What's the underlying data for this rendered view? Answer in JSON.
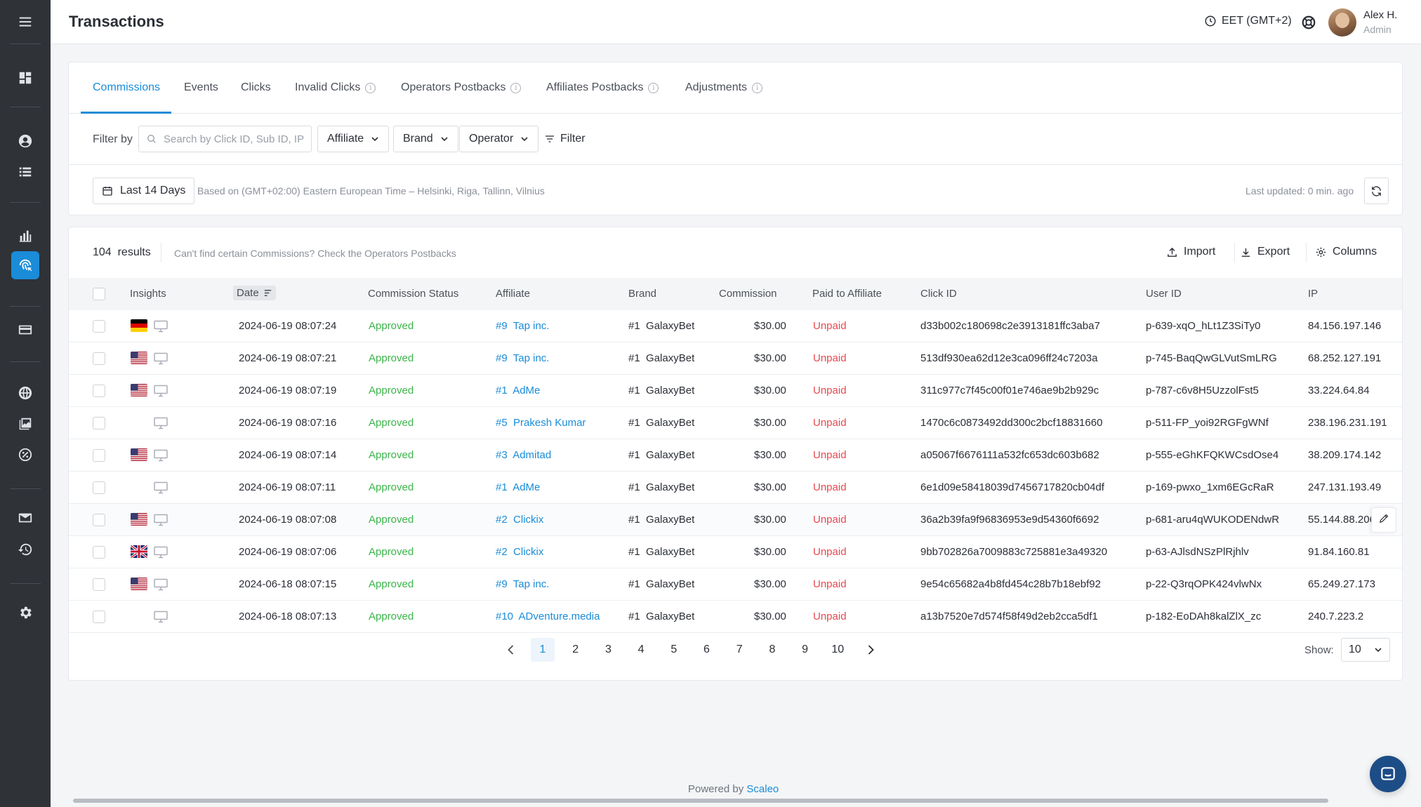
{
  "header": {
    "title": "Transactions",
    "timezone": "EET (GMT+2)",
    "user_name": "Alex H.",
    "user_role": "Admin"
  },
  "sidebar": {
    "icons": [
      "menu-icon",
      "dashboard-icon",
      "user-icon",
      "list-icon",
      "bar-chart-icon",
      "fingerprint-icon",
      "card-icon",
      "globe-icon",
      "image-icon",
      "percent-icon",
      "mail-icon",
      "history-icon",
      "gear-icon"
    ],
    "active": "fingerprint-icon"
  },
  "tabs": [
    {
      "label": "Commissions",
      "active": true,
      "info": false
    },
    {
      "label": "Events",
      "active": false,
      "info": false
    },
    {
      "label": "Clicks",
      "active": false,
      "info": false
    },
    {
      "label": "Invalid Clicks",
      "active": false,
      "info": true
    },
    {
      "label": "Operators Postbacks",
      "active": false,
      "info": true
    },
    {
      "label": "Affiliates Postbacks",
      "active": false,
      "info": true
    },
    {
      "label": "Adjustments",
      "active": false,
      "info": true
    }
  ],
  "filters": {
    "label": "Filter by",
    "search_placeholder": "Search by Click ID, Sub ID, IP",
    "search_value": "",
    "affiliate": "Affiliate",
    "brand": "Brand",
    "operator": "Operator",
    "filter_button": "Filter"
  },
  "date_range": {
    "label": "Last 14 Days",
    "note": "Based on (GMT+02:00) Eastern European Time – Helsinki, Riga, Tallinn, Vilnius",
    "last_updated": "Last updated: 0 min. ago"
  },
  "results": {
    "count": "104",
    "count_label": "results",
    "hint": "Can't find certain Commissions? Check the Operators Postbacks",
    "import": "Import",
    "export": "Export",
    "columns": "Columns"
  },
  "table": {
    "headers": [
      "Insights",
      "Date",
      "Commission Status",
      "Affiliate",
      "Brand",
      "Commission",
      "Paid to Affiliate",
      "Click ID",
      "User ID",
      "IP"
    ],
    "rows": [
      {
        "flag": "de",
        "date": "2024-06-19 08:07:24",
        "status": "Approved",
        "aff_id": "#9",
        "aff_name": "Tap inc.",
        "brand_id": "#1",
        "brand_name": "GalaxyBet",
        "commission": "$30.00",
        "paid": "Unpaid",
        "click_id": "d33b002c180698c2e3913181ffc3aba7",
        "user_id": "p-639-xqO_hLt1Z3SiTy0",
        "ip": "84.156.197.146"
      },
      {
        "flag": "us",
        "date": "2024-06-19 08:07:21",
        "status": "Approved",
        "aff_id": "#9",
        "aff_name": "Tap inc.",
        "brand_id": "#1",
        "brand_name": "GalaxyBet",
        "commission": "$30.00",
        "paid": "Unpaid",
        "click_id": "513df930ea62d12e3ca096ff24c7203a",
        "user_id": "p-745-BaqQwGLVutSmLRG",
        "ip": "68.252.127.191"
      },
      {
        "flag": "us",
        "date": "2024-06-19 08:07:19",
        "status": "Approved",
        "aff_id": "#1",
        "aff_name": "AdMe",
        "brand_id": "#1",
        "brand_name": "GalaxyBet",
        "commission": "$30.00",
        "paid": "Unpaid",
        "click_id": "311c977c7f45c00f01e746ae9b2b929c",
        "user_id": "p-787-c6v8H5UzzolFst5",
        "ip": "33.224.64.84"
      },
      {
        "flag": "",
        "date": "2024-06-19 08:07:16",
        "status": "Approved",
        "aff_id": "#5",
        "aff_name": "Prakesh Kumar",
        "brand_id": "#1",
        "brand_name": "GalaxyBet",
        "commission": "$30.00",
        "paid": "Unpaid",
        "click_id": "1470c6c0873492dd300c2bcf18831660",
        "user_id": "p-511-FP_yoi92RGFgWNf",
        "ip": "238.196.231.191"
      },
      {
        "flag": "us",
        "date": "2024-06-19 08:07:14",
        "status": "Approved",
        "aff_id": "#3",
        "aff_name": "Admitad",
        "brand_id": "#1",
        "brand_name": "GalaxyBet",
        "commission": "$30.00",
        "paid": "Unpaid",
        "click_id": "a05067f6676111a532fc653dc603b682",
        "user_id": "p-555-eGhKFQKWCsdOse4",
        "ip": "38.209.174.142"
      },
      {
        "flag": "",
        "date": "2024-06-19 08:07:11",
        "status": "Approved",
        "aff_id": "#1",
        "aff_name": "AdMe",
        "brand_id": "#1",
        "brand_name": "GalaxyBet",
        "commission": "$30.00",
        "paid": "Unpaid",
        "click_id": "6e1d09e58418039d7456717820cb04df",
        "user_id": "p-169-pwxo_1xm6EGcRaR",
        "ip": "247.131.193.49"
      },
      {
        "flag": "us",
        "date": "2024-06-19 08:07:08",
        "status": "Approved",
        "aff_id": "#2",
        "aff_name": "Clickix",
        "brand_id": "#1",
        "brand_name": "GalaxyBet",
        "commission": "$30.00",
        "paid": "Unpaid",
        "click_id": "36a2b39fa9f96836953e9d54360f6692",
        "user_id": "p-681-aru4qWUKODENdwR",
        "ip": "55.144.88.206"
      },
      {
        "flag": "gb",
        "date": "2024-06-19 08:07:06",
        "status": "Approved",
        "aff_id": "#2",
        "aff_name": "Clickix",
        "brand_id": "#1",
        "brand_name": "GalaxyBet",
        "commission": "$30.00",
        "paid": "Unpaid",
        "click_id": "9bb702826a7009883c725881e3a49320",
        "user_id": "p-63-AJlsdNSzPlRjhlv",
        "ip": "91.84.160.81"
      },
      {
        "flag": "us",
        "date": "2024-06-18 08:07:15",
        "status": "Approved",
        "aff_id": "#9",
        "aff_name": "Tap inc.",
        "brand_id": "#1",
        "brand_name": "GalaxyBet",
        "commission": "$30.00",
        "paid": "Unpaid",
        "click_id": "9e54c65682a4b8fd454c28b7b18ebf92",
        "user_id": "p-22-Q3rqOPK424vlwNx",
        "ip": "65.249.27.173"
      },
      {
        "flag": "",
        "date": "2024-06-18 08:07:13",
        "status": "Approved",
        "aff_id": "#10",
        "aff_name": "ADventure.media",
        "brand_id": "#1",
        "brand_name": "GalaxyBet",
        "commission": "$30.00",
        "paid": "Unpaid",
        "click_id": "a13b7520e7d574f58f49d2eb2cca5df1",
        "user_id": "p-182-EoDAh8kalZlX_zc",
        "ip": "240.7.223.2"
      }
    ]
  },
  "pagination": {
    "pages": [
      "1",
      "2",
      "3",
      "4",
      "5",
      "6",
      "7",
      "8",
      "9",
      "10"
    ],
    "current": "1",
    "show_label": "Show:",
    "show_value": "10"
  },
  "footer": {
    "powered_prefix": "Powered by",
    "powered_brand": "Scaleo"
  },
  "colors": {
    "accent": "#1a8cd8",
    "approved": "#3bb54a",
    "unpaid": "#e9484f",
    "sidebar": "#2f3237"
  }
}
